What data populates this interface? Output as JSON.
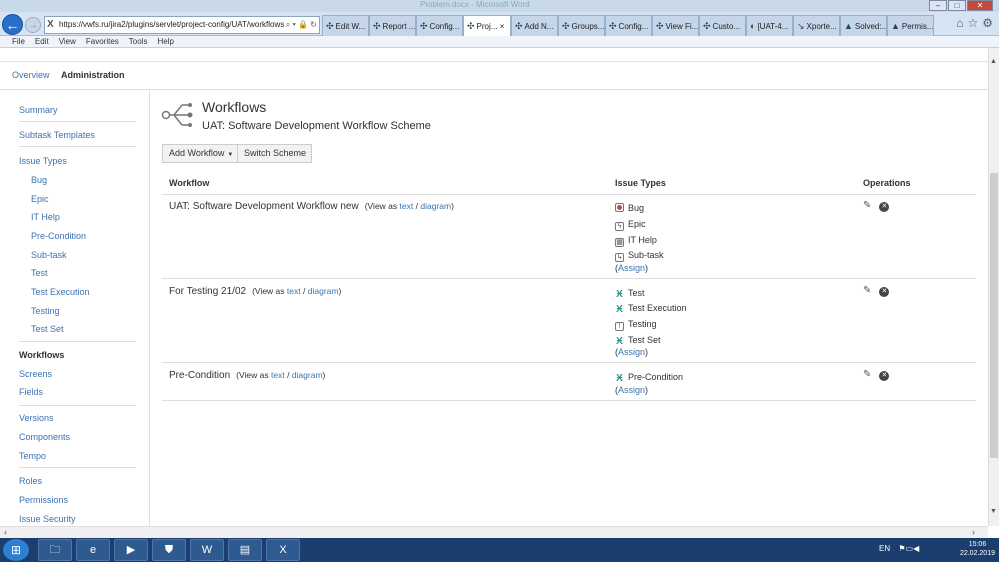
{
  "window_title": "Problem.docx - Microsoft Word",
  "window_buttons": [
    "–",
    "□",
    "✕"
  ],
  "browser": {
    "address": "https://vwfs.ru/jira2/plugins/servlet/project-config/UAT/workflows",
    "address_controls": "⌕ ▾ 🔒 ↻",
    "tabs": [
      "Edit W...",
      "Report ...",
      "Config...",
      "Proj...",
      "Add N...",
      "Groups...",
      "Config...",
      "View Fi...",
      "Custo...",
      "[UAT-4...",
      "Xporte...",
      "Solved:...",
      "Permis..."
    ],
    "active_tab_close": "×",
    "menu": [
      "File",
      "Edit",
      "View",
      "Favorites",
      "Tools",
      "Help"
    ]
  },
  "header_nav": {
    "overview": "Overview",
    "administration": "Administration"
  },
  "sidebar": {
    "summary": "Summary",
    "subtask_templates": "Subtask Templates",
    "issue_types": "Issue Types",
    "issue_type_items": [
      "Bug",
      "Epic",
      "IT Help",
      "Pre-Condition",
      "Sub-task",
      "Test",
      "Test Execution",
      "Testing",
      "Test Set"
    ],
    "workflows": "Workflows",
    "screens": "Screens",
    "fields": "Fields",
    "versions": "Versions",
    "components": "Components",
    "tempo": "Tempo",
    "roles": "Roles",
    "permissions": "Permissions",
    "issue_security": "Issue Security"
  },
  "page": {
    "title": "Workflows",
    "scheme": "UAT: Software Development Workflow Scheme",
    "add_workflow": "Add Workflow",
    "switch_scheme": "Switch Scheme"
  },
  "table": {
    "headers": {
      "workflow": "Workflow",
      "issue_types": "Issue Types",
      "operations": "Operations"
    },
    "view_as": "(View as",
    "text_link": "text",
    "slash": "/",
    "diagram_link": "diagram",
    "close_paren": ")",
    "assign_open": "(",
    "assign": "Assign",
    "assign_close": ")",
    "rows": [
      {
        "name": "UAT: Software Development Workflow new",
        "issue_types": [
          "Bug",
          "Epic",
          "IT Help",
          "Sub-task"
        ]
      },
      {
        "name": "For Testing 21/02",
        "issue_types": [
          "Test",
          "Test Execution",
          "Testing",
          "Test Set"
        ]
      },
      {
        "name": "Pre-Condition",
        "issue_types": [
          "Pre-Condition"
        ]
      }
    ]
  },
  "taskbar": {
    "lang": "EN",
    "time": "15:06",
    "date": "22.02.2019"
  }
}
